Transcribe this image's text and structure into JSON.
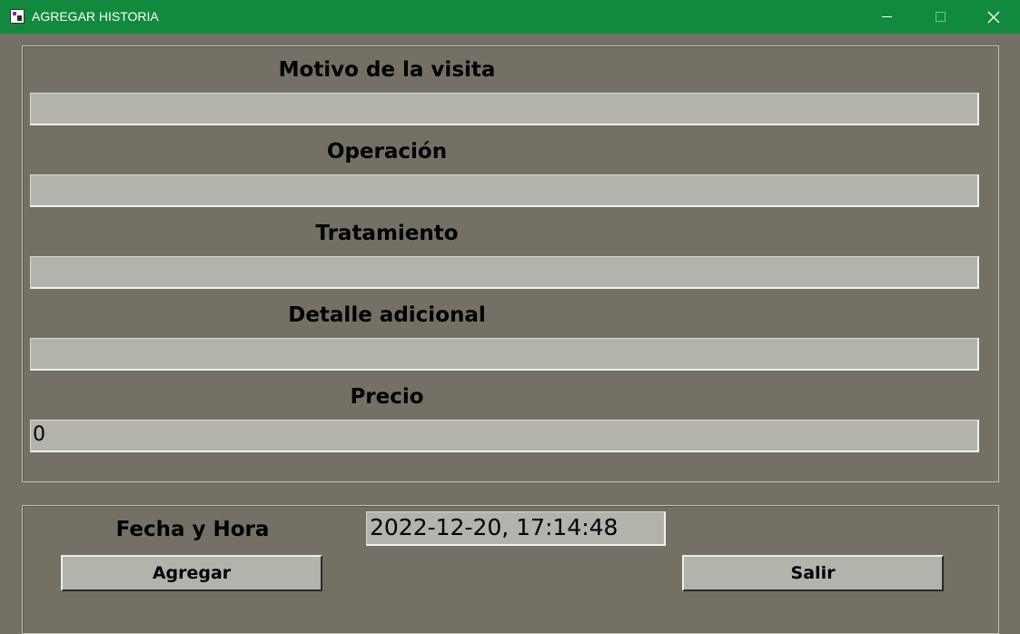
{
  "window": {
    "title": "AGREGAR HISTORIA",
    "accent_color": "#118a3e",
    "background_color": "#757066",
    "controls": {
      "minimize_icon": "minimize-icon",
      "maximize_icon": "maximize-icon",
      "close_icon": "close-icon"
    }
  },
  "form": {
    "motivo": {
      "label": "Motivo de la visita",
      "value": ""
    },
    "operacion": {
      "label": "Operación",
      "value": ""
    },
    "tratamiento": {
      "label": "Tratamiento",
      "value": ""
    },
    "detalle": {
      "label": "Detalle adicional",
      "value": ""
    },
    "precio": {
      "label": "Precio",
      "value": "0"
    }
  },
  "footer": {
    "fecha_label": "Fecha y Hora",
    "fecha_value": "2022-12-20, 17:14:48",
    "add_button": "Agregar",
    "exit_button": "Salir"
  }
}
